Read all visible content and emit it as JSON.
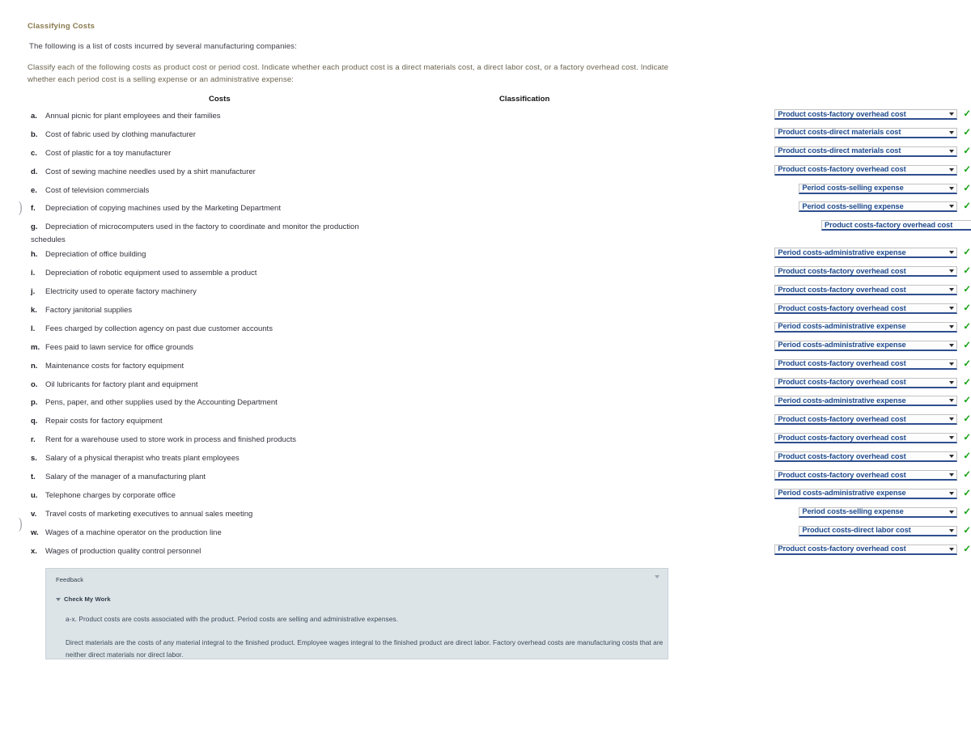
{
  "title": "Classifying Costs",
  "intro": {
    "line1": "The following is a list of costs incurred by several manufacturing companies:",
    "line2": "Classify each of the following costs as product cost or period cost. Indicate whether each product cost is a direct materials cost, a direct labor cost, or a factory overhead cost. Indicate whether each period cost is a selling expense or an administrative expense:"
  },
  "headers": {
    "costs": "Costs",
    "classification": "Classification"
  },
  "rows": [
    {
      "letter": "a.",
      "text": "Annual picnic for plant employees and their families",
      "classification": "Product costs-factory overhead cost",
      "width": "wide",
      "checked": "✓"
    },
    {
      "letter": "b.",
      "text": "Cost of fabric used by clothing manufacturer",
      "classification": "Product costs-direct materials cost",
      "width": "wide",
      "checked": "✓"
    },
    {
      "letter": "c.",
      "text": "Cost of plastic for a toy manufacturer",
      "classification": "Product costs-direct materials cost",
      "width": "wide",
      "checked": "✓"
    },
    {
      "letter": "d.",
      "text": "Cost of sewing machine needles used by a shirt manufacturer",
      "classification": "Product costs-factory overhead cost",
      "width": "wide",
      "checked": "✓"
    },
    {
      "letter": "e.",
      "text": "Cost of television commercials",
      "classification": "Period costs-selling expense",
      "width": "narrow",
      "checked": "✓"
    },
    {
      "letter": "f.",
      "text": "Depreciation of copying machines used by the Marketing Department",
      "classification": "Period costs-selling expense",
      "width": "narrow",
      "checked": "✓"
    },
    {
      "letter": "g.",
      "text": "Depreciation of microcomputers used in the factory to coordinate and monitor the production",
      "text2": "schedules",
      "classification": "Product costs-factory overhead cost",
      "width": "wide",
      "checked": "✓"
    },
    {
      "letter": "h.",
      "text": "Depreciation of office building",
      "classification": "Period costs-administrative expense",
      "width": "wide",
      "checked": "✓"
    },
    {
      "letter": "i.",
      "text": "Depreciation of robotic equipment used to assemble a product",
      "classification": "Product costs-factory overhead cost",
      "width": "wide",
      "checked": "✓"
    },
    {
      "letter": "j.",
      "text": "Electricity used to operate factory machinery",
      "classification": "Product costs-factory overhead cost",
      "width": "wide",
      "checked": "✓"
    },
    {
      "letter": "k.",
      "text": "Factory janitorial supplies",
      "classification": "Product costs-factory overhead cost",
      "width": "wide",
      "checked": "✓"
    },
    {
      "letter": "l.",
      "text": "Fees charged by collection agency on past due customer accounts",
      "classification": "Period costs-administrative expense",
      "width": "wide",
      "checked": "✓"
    },
    {
      "letter": "m.",
      "text": "Fees paid to lawn service for office grounds",
      "classification": "Period costs-administrative expense",
      "width": "wide",
      "checked": "✓"
    },
    {
      "letter": "n.",
      "text": "Maintenance costs for factory equipment",
      "classification": "Product costs-factory overhead cost",
      "width": "wide",
      "checked": "✓"
    },
    {
      "letter": "o.",
      "text": "Oil lubricants for factory plant and equipment",
      "classification": "Product costs-factory overhead cost",
      "width": "wide",
      "checked": "✓"
    },
    {
      "letter": "p.",
      "text": "Pens, paper, and other supplies used by the Accounting Department",
      "classification": "Period costs-administrative expense",
      "width": "wide",
      "checked": "✓"
    },
    {
      "letter": "q.",
      "text": "Repair costs for factory equipment",
      "classification": "Product costs-factory overhead cost",
      "width": "wide",
      "checked": "✓"
    },
    {
      "letter": "r.",
      "text": "Rent for a warehouse used to store work in process and finished products",
      "classification": "Product costs-factory overhead cost",
      "width": "wide",
      "checked": "✓"
    },
    {
      "letter": "s.",
      "text": "Salary of a physical therapist who treats plant employees",
      "classification": "Product costs-factory overhead cost",
      "width": "wide",
      "checked": "✓"
    },
    {
      "letter": "t.",
      "text": "Salary of the manager of a manufacturing plant",
      "classification": "Product costs-factory overhead cost",
      "width": "wide",
      "checked": "✓"
    },
    {
      "letter": "u.",
      "text": "Telephone charges by corporate office",
      "classification": "Period costs-administrative expense",
      "width": "wide",
      "checked": "✓"
    },
    {
      "letter": "v.",
      "text": "Travel costs of marketing executives to annual sales meeting",
      "classification": "Period costs-selling expense",
      "width": "narrow",
      "checked": "✓"
    },
    {
      "letter": "w.",
      "text": "Wages of a machine operator on the production line",
      "classification": "Product costs-direct labor cost",
      "width": "narrow",
      "checked": "✓"
    },
    {
      "letter": "x.",
      "text": "Wages of production quality control personnel",
      "classification": "Product costs-factory overhead cost",
      "width": "wide",
      "checked": "✓"
    }
  ],
  "feedback": {
    "title": "Feedback",
    "check_my_work": "Check My Work",
    "paragraph1": "a-x. Product costs are costs associated with the product. Period costs are selling and administrative expenses.",
    "paragraph2": "Direct materials are the costs of any material integral to the finished product. Employee wages integral to the finished product are direct labor. Factory overhead costs are manufacturing costs that are neither direct materials nor direct labor."
  },
  "colors": {
    "title": "#8a7a4e",
    "select_text": "#1f4b8e",
    "select_underline": "#2f4f8f",
    "check": "#13a213",
    "feedback_bg": "#dde4e8"
  }
}
